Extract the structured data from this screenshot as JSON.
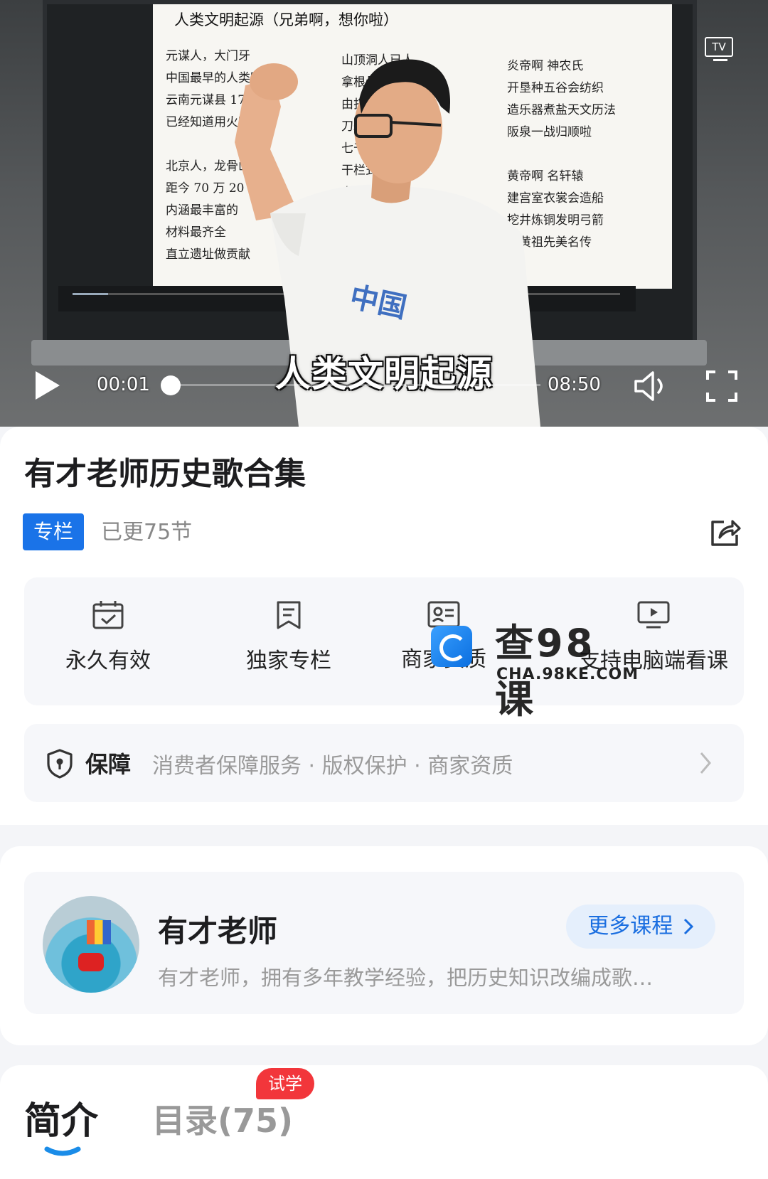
{
  "video": {
    "slide_title": "人类文明起源（兄弟啊，想你啦）",
    "slide_col1": [
      "元谋人，大门牙",
      "中国最早的人类啊",
      "云南元谋县 170 万",
      "已经知道用火呦",
      "",
      "北京人，龙骨山",
      "距今 70 万 20 万",
      "内涵最丰富的",
      "材料最齐全",
      "直立遗址做贡献"
    ],
    "slide_col2": [
      "山顶洞人已人",
      "拿根骨针",
      "由打制到",
      "刀耕火",
      "七千年",
      "干栏式",
      "六千年黄河"
    ],
    "slide_col3": [
      "炎帝啊 神农氏",
      "开垦种五谷会纺织",
      "造乐器煮盐天文历法",
      "阪泉一战归顺啦",
      "",
      "黄帝啊 名轩辕",
      "建宫室衣裳会造船",
      "挖井炼铜发明弓箭",
      "炎黄祖先美名传"
    ],
    "tv_label": "TV",
    "subtitle": "人类文明起源",
    "current_time": "00:01",
    "total_time": "08:50",
    "progress": 0.002
  },
  "course": {
    "title": "有才老师历史歌合集",
    "tag": "专栏",
    "updated": "已更75节"
  },
  "features": [
    {
      "label": "永久有效",
      "icon": "calendar-check-icon"
    },
    {
      "label": "独家专栏",
      "icon": "bookmark-icon"
    },
    {
      "label": "商家资质",
      "icon": "id-card-icon"
    },
    {
      "label": "支持电脑端看课",
      "icon": "monitor-play-icon"
    }
  ],
  "guarantee": {
    "title": "保障",
    "items": "消费者保障服务 · 版权保护 · 商家资质"
  },
  "watermark": {
    "cn": "查98课",
    "en": "CHA.98KE.COM"
  },
  "teacher": {
    "name": "有才老师",
    "more_label": "更多课程",
    "description": "有才老师，拥有多年教学经验，把历史知识改编成歌…"
  },
  "tabs": {
    "intro": "简介",
    "catalog": "目录(75)",
    "trial_badge": "试学"
  },
  "colors": {
    "brand_blue": "#1a73e8",
    "trial_red": "#f2363b",
    "more_bg": "#e5effc"
  }
}
